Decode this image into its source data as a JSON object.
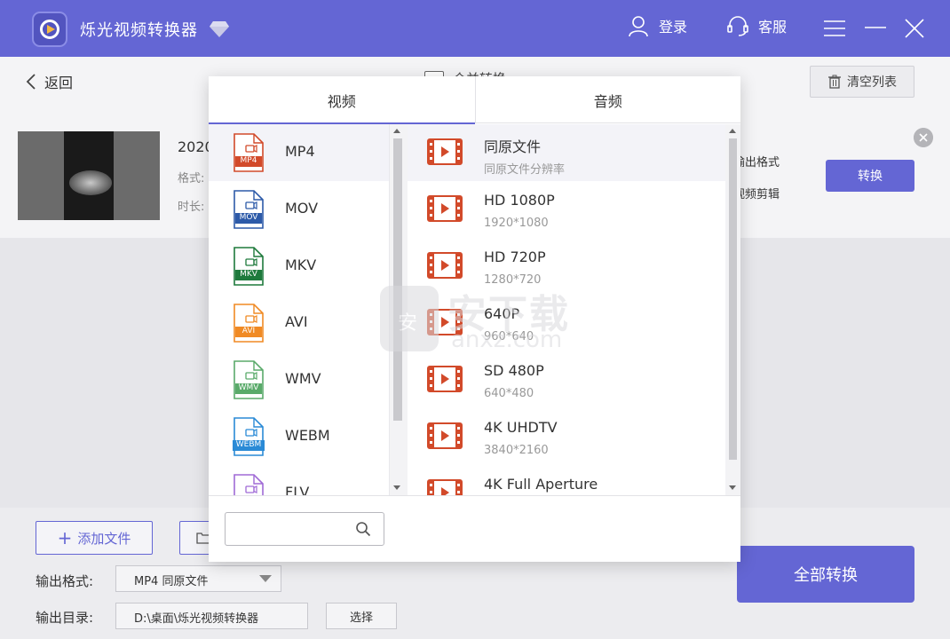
{
  "app": {
    "title": "烁光视频转换器",
    "accent": "#6466d4"
  },
  "titlebar": {
    "login_label": "登录",
    "service_label": "客服"
  },
  "subheader": {
    "back_label": "返回",
    "merge_label": "合并转换",
    "clear_label": "清空列表"
  },
  "file": {
    "name": "2020",
    "format_label": "格式:",
    "duration_label": "时长:",
    "output_format_label": "输出格式",
    "edit_label": "视频剪辑",
    "convert_label": "转换"
  },
  "popup": {
    "tabs": [
      {
        "label": "视频",
        "active": true
      },
      {
        "label": "音频",
        "active": false
      }
    ],
    "formats": [
      {
        "name": "MP4",
        "tag": "MP4",
        "color": "#d24a2a",
        "selected": true
      },
      {
        "name": "MOV",
        "tag": "MOV",
        "color": "#2d5aa8",
        "selected": false
      },
      {
        "name": "MKV",
        "tag": "MKV",
        "color": "#1e7a3c",
        "selected": false
      },
      {
        "name": "AVI",
        "tag": "AVI",
        "color": "#f08a24",
        "selected": false
      },
      {
        "name": "WMV",
        "tag": "WMV",
        "color": "#5aaa6a",
        "selected": false
      },
      {
        "name": "WEBM",
        "tag": "WEBM",
        "color": "#2a8ad6",
        "selected": false
      },
      {
        "name": "FLV",
        "tag": "FLV",
        "color": "#a06ad6",
        "selected": false
      }
    ],
    "resolutions": [
      {
        "title": "同原文件",
        "sub": "同原文件分辨率",
        "selected": true
      },
      {
        "title": "HD 1080P",
        "sub": "1920*1080",
        "selected": false
      },
      {
        "title": "HD 720P",
        "sub": "1280*720",
        "selected": false
      },
      {
        "title": "640P",
        "sub": "960*640",
        "selected": false
      },
      {
        "title": "SD 480P",
        "sub": "640*480",
        "selected": false
      },
      {
        "title": "4K UHDTV",
        "sub": "3840*2160",
        "selected": false
      },
      {
        "title": "4K Full Aperture",
        "sub": "",
        "selected": false
      }
    ],
    "search": {
      "value": "",
      "placeholder": ""
    }
  },
  "bottom": {
    "add_file_label": "添加文件",
    "output_format_label": "输出格式:",
    "output_format_value": "MP4 同原文件",
    "output_dir_label": "输出目录:",
    "output_dir_value": "D:\\桌面\\烁光视频转换器",
    "choose_label": "选择",
    "convert_all_label": "全部转换"
  },
  "watermark": {
    "shield_text": "安",
    "cn": "安下载",
    "en": "anxz.com"
  }
}
